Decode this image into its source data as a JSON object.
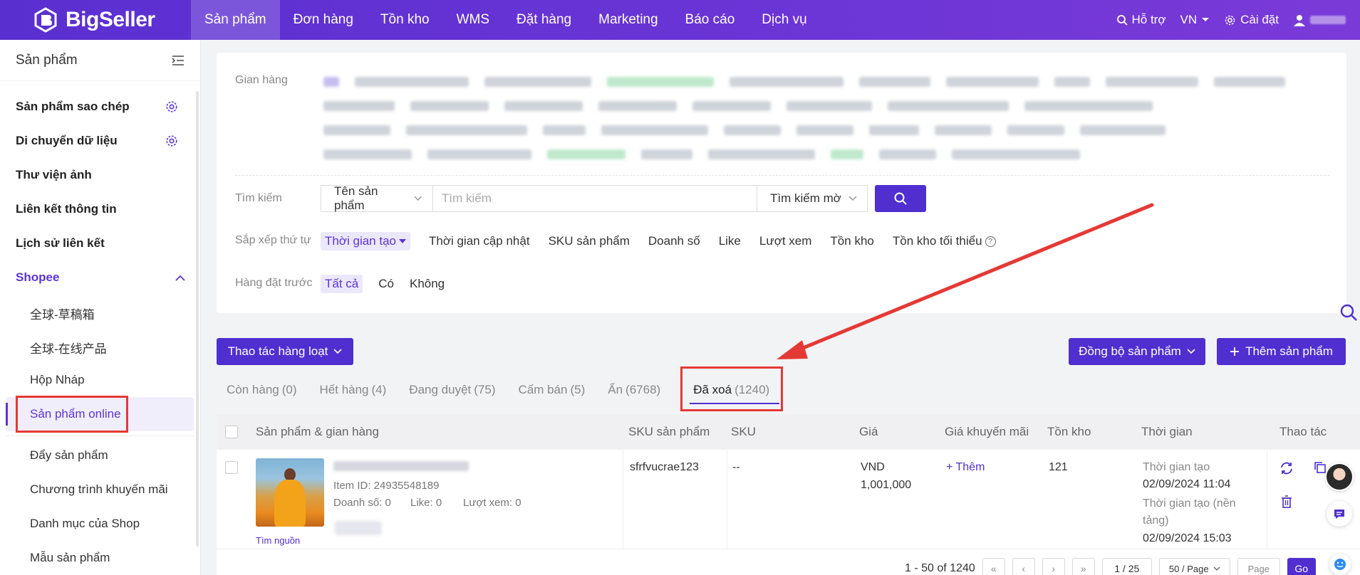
{
  "app": {
    "logo_text": "BigSeller"
  },
  "nav": {
    "items": [
      "Sản phẩm",
      "Đơn hàng",
      "Tồn kho",
      "WMS",
      "Đặt hàng",
      "Marketing",
      "Báo cáo",
      "Dịch vụ"
    ],
    "support": "Hỗ trợ",
    "lang": "VN",
    "settings": "Cài đặt"
  },
  "sidebar": {
    "title": "Sản phẩm",
    "main_items": [
      "Sản phẩm sao chép",
      "Di chuyển dữ liệu",
      "Thư viện ảnh",
      "Liên kết thông tin",
      "Lịch sử liên kết"
    ],
    "shopee_label": "Shopee",
    "shopee_items": [
      "全球-草稿箱",
      "全球-在线产品",
      "Hộp Nháp",
      "Sản phẩm online"
    ],
    "other_items": [
      "Đẩy sản phẩm",
      "Chương trình khuyến mãi",
      "Danh mục của Shop",
      "Mẫu sản phẩm"
    ]
  },
  "filter": {
    "shop_label": "Gian hàng",
    "search_label": "Tìm kiếm",
    "search_field_select": "Tên sản phẩm",
    "search_placeholder": "Tìm kiếm",
    "search_mode_select": "Tìm kiếm mờ",
    "sort_label": "Sắp xếp thứ tự",
    "sort_options": [
      "Thời gian tạo",
      "Thời gian cập nhật",
      "SKU sản phẩm",
      "Doanh số",
      "Like",
      "Lượt xem",
      "Tồn kho",
      "Tồn kho tối thiểu"
    ],
    "preorder_label": "Hàng đặt trước",
    "preorder_options": [
      "Tất cả",
      "Có",
      "Không"
    ]
  },
  "actions": {
    "bulk": "Thao tác hàng loạt",
    "sync": "Đồng bộ sản phẩm",
    "add": "Thêm sản phẩm"
  },
  "tabs": [
    {
      "label": "Còn hàng",
      "count": "(0)"
    },
    {
      "label": "Hết hàng",
      "count": "(4)"
    },
    {
      "label": "Đang duyệt",
      "count": "(75)"
    },
    {
      "label": "Cấm bán",
      "count": "(5)"
    },
    {
      "label": "Ẩn",
      "count": "(6768)"
    },
    {
      "label": "Đã xoá",
      "count": "(1240)"
    }
  ],
  "table": {
    "headers": [
      "Sản phẩm & gian hàng",
      "SKU sản phẩm",
      "SKU",
      "Giá",
      "Giá khuyến mãi",
      "Tồn kho",
      "Thời gian",
      "Thao tác"
    ],
    "row": {
      "item_id": "Item ID: 24935548189",
      "sales": "Doanh số: 0",
      "likes": "Like: 0",
      "views": "Lượt xem: 0",
      "find_source": "Tìm nguồn",
      "product_sku": "sfrfvucrae123",
      "sku": "--",
      "price_currency": "VND",
      "price_value": "1,001,000",
      "promo": "+ Thêm",
      "stock": "121",
      "created_label": "Thời gian tạo",
      "created_time": "02/09/2024 11:04",
      "platform_created_label": "Thời gian tạo (nền tảng)",
      "platform_created_time": "02/09/2024 15:03"
    }
  },
  "pagination": {
    "summary": "1 - 50 of 1240",
    "page": "1 / 25",
    "per_page": "50 / Page",
    "page_placeholder": "Page",
    "go": "Go"
  },
  "colors": {
    "brand": "#4f2fd0",
    "highlight": "#e53935"
  }
}
